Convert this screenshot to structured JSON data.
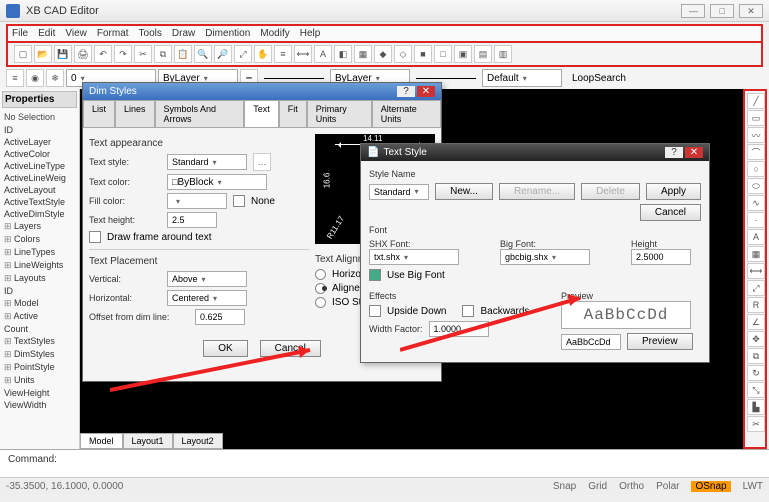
{
  "app": {
    "title": "XB CAD Editor"
  },
  "menu": {
    "items": [
      "File",
      "Edit",
      "View",
      "Format",
      "Tools",
      "Draw",
      "Dimention",
      "Modify",
      "Help"
    ]
  },
  "combo": {
    "layer0": "0",
    "bylayer1": "ByLayer",
    "linestyle": "ByLayer",
    "lineweight": "Default",
    "loop": "LoopSearch"
  },
  "properties": {
    "header": "Properties",
    "nosel": "No Selection",
    "items": [
      "ID",
      "ActiveLayer",
      "ActiveColor",
      "ActiveLineType",
      "ActiveLineWeig",
      "ActiveLayout",
      "ActiveTextStyle",
      "ActiveDimStyle"
    ],
    "trees": [
      "Layers",
      "Colors",
      "LineTypes",
      "LineWeights",
      "Layouts",
      "ID",
      "Model",
      "Active",
      "Count",
      "TextStyles",
      "DimStyles",
      "PointStyle",
      "Units"
    ],
    "bottom": [
      "ViewHeight",
      "ViewWidth"
    ]
  },
  "dim_dialog": {
    "title": "Dim Styles",
    "tabs": [
      "List",
      "Lines",
      "Symbols And Arrows",
      "Text",
      "Fit",
      "Primary Units",
      "Alternate Units"
    ],
    "active_tab": "Text",
    "appearance": {
      "heading": "Text appearance",
      "text_style_lbl": "Text style:",
      "text_style": "Standard",
      "text_color_lbl": "Text color:",
      "text_color": "ByBlock",
      "fill_color_lbl": "Fill color:",
      "fill_none": "None",
      "height_lbl": "Text height:",
      "height": "2.5",
      "draw_frame": "Draw frame around text"
    },
    "placement": {
      "heading": "Text Placement",
      "vertical_lbl": "Vertical:",
      "vertical": "Above",
      "horizontal_lbl": "Horizontal:",
      "horizontal": "Centered",
      "offset_lbl": "Offset from dim line:",
      "offset": "0.625"
    },
    "alignment": {
      "heading": "Text Alignment",
      "horizontal": "Horizontal",
      "aligned": "Aligned with",
      "iso": "ISO Standard"
    },
    "preview": {
      "top": "14.11",
      "left": "16.6",
      "diag": "R11.17"
    },
    "buttons": {
      "ok": "OK",
      "cancel": "Cancel"
    }
  },
  "text_dialog": {
    "title": "Text Style",
    "style_name_lbl": "Style Name",
    "style_name": "Standard",
    "new_btn": "New...",
    "rename_btn": "Rename...",
    "delete_btn": "Delete",
    "apply_btn": "Apply",
    "cancel_btn": "Cancel",
    "font_heading": "Font",
    "shx_font_lbl": "SHX Font:",
    "shx_font": "txt.shx",
    "big_font_lbl": "Big Font:",
    "big_font": "gbcbig.shx",
    "height_lbl": "Height",
    "height": "2.5000",
    "use_big_font": "Use Big Font",
    "effects_heading": "Effects",
    "upside_down": "Upside Down",
    "backwards": "Backwards",
    "width_factor_lbl": "Width Factor:",
    "width_factor": "1.0000",
    "preview_heading": "Preview",
    "preview_text": "AaBbCcDd",
    "preview_input": "AaBbCcDd",
    "preview_btn": "Preview"
  },
  "tabs": {
    "model": "Model",
    "layout1": "Layout1",
    "layout2": "Layout2"
  },
  "cmd": {
    "label": "Command:"
  },
  "status": {
    "coords": "-35.3500, 16.1000, 0.0000",
    "toggles": [
      "Snap",
      "Grid",
      "Ortho",
      "Polar",
      "OSnap",
      "LWT"
    ]
  }
}
